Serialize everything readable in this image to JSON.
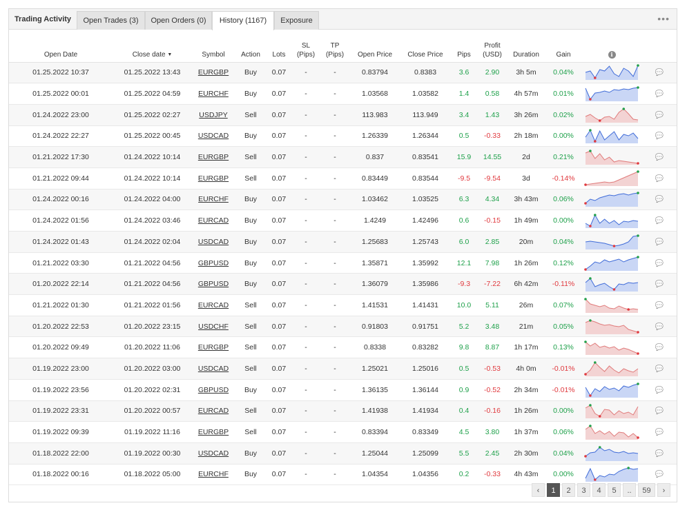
{
  "tabs": {
    "title": "Trading Activity",
    "items": [
      {
        "label": "Open Trades (3)"
      },
      {
        "label": "Open Orders (0)"
      },
      {
        "label": "History (1167)"
      },
      {
        "label": "Exposure"
      }
    ],
    "menu": "•••"
  },
  "headers": {
    "open_date": "Open Date",
    "close_date": "Close date",
    "symbol": "Symbol",
    "action": "Action",
    "lots": "Lots",
    "sl_1": "SL",
    "sl_2": "(Pips)",
    "tp_1": "TP",
    "tp_2": "(Pips)",
    "open_price": "Open Price",
    "close_price": "Close Price",
    "pips": "Pips",
    "profit_1": "Profit",
    "profit_2": "(USD)",
    "duration": "Duration",
    "gain": "Gain",
    "info": "i"
  },
  "rows": [
    {
      "open": "01.25.2022 10:37",
      "close": "01.25.2022 13:43",
      "symbol": "EURGBP",
      "action": "Buy",
      "lots": "0.07",
      "sl": "-",
      "tp": "-",
      "op": "0.83794",
      "cp": "0.8383",
      "pips": "3.6",
      "profit": "2.90",
      "dur": "3h 5m",
      "gain": "0.04%",
      "spark": [
        0.5,
        0.6,
        0.1,
        0.7,
        0.6,
        0.95,
        0.4,
        0.2,
        0.8,
        0.6,
        0.2,
        1.0
      ]
    },
    {
      "open": "01.25.2022 00:01",
      "close": "01.25.2022 04:59",
      "symbol": "EURCHF",
      "action": "Buy",
      "lots": "0.07",
      "sl": "-",
      "tp": "-",
      "op": "1.03568",
      "cp": "1.03582",
      "pips": "1.4",
      "profit": "0.58",
      "dur": "4h 57m",
      "gain": "0.01%",
      "spark": [
        0.9,
        0.1,
        0.55,
        0.6,
        0.7,
        0.6,
        0.8,
        0.75,
        0.85,
        0.8,
        0.9,
        0.95
      ]
    },
    {
      "open": "01.24.2022 23:00",
      "close": "01.25.2022 02:27",
      "symbol": "USDJPY",
      "action": "Sell",
      "lots": "0.07",
      "sl": "-",
      "tp": "-",
      "op": "113.983",
      "cp": "113.949",
      "pips": "3.4",
      "profit": "1.43",
      "dur": "3h 26m",
      "gain": "0.02%",
      "spark": [
        0.4,
        0.55,
        0.3,
        0.1,
        0.35,
        0.4,
        0.2,
        0.7,
        0.95,
        0.6,
        0.2,
        0.15
      ]
    },
    {
      "open": "01.24.2022 22:27",
      "close": "01.25.2022 00:45",
      "symbol": "USDCAD",
      "action": "Buy",
      "lots": "0.07",
      "sl": "-",
      "tp": "-",
      "op": "1.26339",
      "cp": "1.26344",
      "pips": "0.5",
      "profit": "-0.33",
      "dur": "2h 18m",
      "gain": "0.00%",
      "spark": [
        0.4,
        0.9,
        0.1,
        0.85,
        0.2,
        0.5,
        0.8,
        0.2,
        0.6,
        0.5,
        0.7,
        0.3
      ]
    },
    {
      "open": "01.21.2022 17:30",
      "close": "01.24.2022 10:14",
      "symbol": "EURGBP",
      "action": "Sell",
      "lots": "0.07",
      "sl": "-",
      "tp": "-",
      "op": "0.837",
      "cp": "0.83541",
      "pips": "15.9",
      "profit": "14.55",
      "dur": "2d",
      "gain": "0.21%",
      "spark": [
        0.8,
        0.95,
        0.4,
        0.75,
        0.3,
        0.5,
        0.15,
        0.25,
        0.2,
        0.15,
        0.1,
        0.05
      ]
    },
    {
      "open": "01.21.2022 09:44",
      "close": "01.24.2022 10:14",
      "symbol": "EURGBP",
      "action": "Sell",
      "lots": "0.07",
      "sl": "-",
      "tp": "-",
      "op": "0.83449",
      "cp": "0.83544",
      "pips": "-9.5",
      "profit": "-9.54",
      "dur": "3d",
      "gain": "-0.14%",
      "spark": [
        0.05,
        0.1,
        0.15,
        0.2,
        0.25,
        0.2,
        0.25,
        0.4,
        0.55,
        0.7,
        0.85,
        1.0
      ]
    },
    {
      "open": "01.24.2022 00:16",
      "close": "01.24.2022 04:00",
      "symbol": "EURCHF",
      "action": "Buy",
      "lots": "0.07",
      "sl": "-",
      "tp": "-",
      "op": "1.03462",
      "cp": "1.03525",
      "pips": "6.3",
      "profit": "4.34",
      "dur": "3h 43m",
      "gain": "0.06%",
      "spark": [
        0.2,
        0.5,
        0.4,
        0.6,
        0.7,
        0.8,
        0.75,
        0.85,
        0.9,
        0.8,
        0.9,
        0.95
      ]
    },
    {
      "open": "01.24.2022 01:56",
      "close": "01.24.2022 03:46",
      "symbol": "EURCAD",
      "action": "Buy",
      "lots": "0.07",
      "sl": "-",
      "tp": "-",
      "op": "1.4249",
      "cp": "1.42496",
      "pips": "0.6",
      "profit": "-0.15",
      "dur": "1h 49m",
      "gain": "0.00%",
      "spark": [
        0.3,
        0.1,
        0.9,
        0.3,
        0.6,
        0.3,
        0.5,
        0.2,
        0.45,
        0.4,
        0.5,
        0.45
      ]
    },
    {
      "open": "01.24.2022 01:43",
      "close": "01.24.2022 02:04",
      "symbol": "USDCAD",
      "action": "Buy",
      "lots": "0.07",
      "sl": "-",
      "tp": "-",
      "op": "1.25683",
      "cp": "1.25743",
      "pips": "6.0",
      "profit": "2.85",
      "dur": "20m",
      "gain": "0.04%",
      "spark": [
        0.5,
        0.55,
        0.5,
        0.45,
        0.4,
        0.3,
        0.2,
        0.25,
        0.35,
        0.5,
        0.9,
        0.95
      ]
    },
    {
      "open": "01.21.2022 03:30",
      "close": "01.21.2022 04:56",
      "symbol": "GBPUSD",
      "action": "Buy",
      "lots": "0.07",
      "sl": "-",
      "tp": "-",
      "op": "1.35871",
      "cp": "1.35992",
      "pips": "12.1",
      "profit": "7.98",
      "dur": "1h 26m",
      "gain": "0.12%",
      "spark": [
        0.05,
        0.3,
        0.6,
        0.5,
        0.75,
        0.6,
        0.7,
        0.8,
        0.6,
        0.75,
        0.85,
        0.95
      ]
    },
    {
      "open": "01.20.2022 22:14",
      "close": "01.21.2022 04:56",
      "symbol": "GBPUSD",
      "action": "Buy",
      "lots": "0.07",
      "sl": "-",
      "tp": "-",
      "op": "1.36079",
      "cp": "1.35986",
      "pips": "-9.3",
      "profit": "-7.22",
      "dur": "6h 42m",
      "gain": "-0.11%",
      "spark": [
        0.6,
        0.9,
        0.3,
        0.45,
        0.55,
        0.3,
        0.1,
        0.5,
        0.45,
        0.6,
        0.55,
        0.6
      ]
    },
    {
      "open": "01.21.2022 01:30",
      "close": "01.21.2022 01:56",
      "symbol": "EURCAD",
      "action": "Sell",
      "lots": "0.07",
      "sl": "-",
      "tp": "-",
      "op": "1.41531",
      "cp": "1.41431",
      "pips": "10.0",
      "profit": "5.11",
      "dur": "26m",
      "gain": "0.07%",
      "spark": [
        0.95,
        0.6,
        0.5,
        0.4,
        0.5,
        0.3,
        0.25,
        0.45,
        0.3,
        0.2,
        0.25,
        0.2
      ]
    },
    {
      "open": "01.20.2022 22:53",
      "close": "01.20.2022 23:15",
      "symbol": "USDCHF",
      "action": "Sell",
      "lots": "0.07",
      "sl": "-",
      "tp": "-",
      "op": "0.91803",
      "cp": "0.91751",
      "pips": "5.2",
      "profit": "3.48",
      "dur": "21m",
      "gain": "0.05%",
      "spark": [
        0.8,
        0.95,
        0.85,
        0.7,
        0.6,
        0.65,
        0.55,
        0.5,
        0.6,
        0.3,
        0.2,
        0.1
      ]
    },
    {
      "open": "01.20.2022 09:49",
      "close": "01.20.2022 11:06",
      "symbol": "EURGBP",
      "action": "Sell",
      "lots": "0.07",
      "sl": "-",
      "tp": "-",
      "op": "0.8338",
      "cp": "0.83282",
      "pips": "9.8",
      "profit": "8.87",
      "dur": "1h 17m",
      "gain": "0.13%",
      "spark": [
        0.9,
        0.6,
        0.8,
        0.5,
        0.6,
        0.45,
        0.55,
        0.3,
        0.45,
        0.35,
        0.2,
        0.05
      ]
    },
    {
      "open": "01.19.2022 23:00",
      "close": "01.20.2022 03:00",
      "symbol": "USDCAD",
      "action": "Sell",
      "lots": "0.07",
      "sl": "-",
      "tp": "-",
      "op": "1.25021",
      "cp": "1.25016",
      "pips": "0.5",
      "profit": "-0.53",
      "dur": "4h 0m",
      "gain": "-0.01%",
      "spark": [
        0.1,
        0.4,
        0.95,
        0.6,
        0.3,
        0.7,
        0.4,
        0.2,
        0.5,
        0.35,
        0.25,
        0.5
      ]
    },
    {
      "open": "01.19.2022 23:56",
      "close": "01.20.2022 02:31",
      "symbol": "GBPUSD",
      "action": "Buy",
      "lots": "0.07",
      "sl": "-",
      "tp": "-",
      "op": "1.36135",
      "cp": "1.36144",
      "pips": "0.9",
      "profit": "-0.52",
      "dur": "2h 34m",
      "gain": "-0.01%",
      "spark": [
        0.7,
        0.1,
        0.6,
        0.4,
        0.75,
        0.55,
        0.65,
        0.45,
        0.8,
        0.7,
        0.85,
        0.95
      ]
    },
    {
      "open": "01.19.2022 23:31",
      "close": "01.20.2022 00:57",
      "symbol": "EURCAD",
      "action": "Sell",
      "lots": "0.07",
      "sl": "-",
      "tp": "-",
      "op": "1.41938",
      "cp": "1.41934",
      "pips": "0.4",
      "profit": "-0.16",
      "dur": "1h 26m",
      "gain": "0.00%",
      "spark": [
        0.7,
        0.9,
        0.3,
        0.1,
        0.6,
        0.55,
        0.2,
        0.5,
        0.3,
        0.4,
        0.2,
        0.8
      ]
    },
    {
      "open": "01.19.2022 09:39",
      "close": "01.19.2022 11:16",
      "symbol": "EURGBP",
      "action": "Sell",
      "lots": "0.07",
      "sl": "-",
      "tp": "-",
      "op": "0.83394",
      "cp": "0.83349",
      "pips": "4.5",
      "profit": "3.80",
      "dur": "1h 37m",
      "gain": "0.06%",
      "spark": [
        0.7,
        0.95,
        0.4,
        0.6,
        0.35,
        0.55,
        0.2,
        0.5,
        0.45,
        0.15,
        0.4,
        0.1
      ]
    },
    {
      "open": "01.18.2022 22:00",
      "close": "01.19.2022 00:30",
      "symbol": "USDCAD",
      "action": "Buy",
      "lots": "0.07",
      "sl": "-",
      "tp": "-",
      "op": "1.25044",
      "cp": "1.25099",
      "pips": "5.5",
      "profit": "2.45",
      "dur": "2h 30m",
      "gain": "0.04%",
      "spark": [
        0.3,
        0.55,
        0.6,
        0.95,
        0.7,
        0.8,
        0.6,
        0.55,
        0.65,
        0.5,
        0.55,
        0.5
      ]
    },
    {
      "open": "01.18.2022 00:16",
      "close": "01.18.2022 05:00",
      "symbol": "EURCHF",
      "action": "Buy",
      "lots": "0.07",
      "sl": "-",
      "tp": "-",
      "op": "1.04354",
      "cp": "1.04356",
      "pips": "0.2",
      "profit": "-0.33",
      "dur": "4h 43m",
      "gain": "0.00%",
      "spark": [
        0.2,
        0.9,
        0.1,
        0.4,
        0.3,
        0.5,
        0.45,
        0.7,
        0.85,
        0.95,
        0.85,
        0.9
      ]
    }
  ],
  "pagination": {
    "prev": "‹",
    "pages": [
      "1",
      "2",
      "3",
      "4",
      "5"
    ],
    "ellipsis": "..",
    "last": "59",
    "next": "›",
    "active": "1"
  },
  "colors": {
    "buy_fill": "#c9d6f5",
    "buy_line": "#3f6bd8",
    "sell_fill": "#f3d3d3",
    "sell_line": "#e07a7a",
    "marker_high": "#22a04a",
    "marker_low": "#e0393e",
    "marker_end": "#f59a23",
    "positive": "#1ea04a",
    "negative": "#e0393e"
  }
}
